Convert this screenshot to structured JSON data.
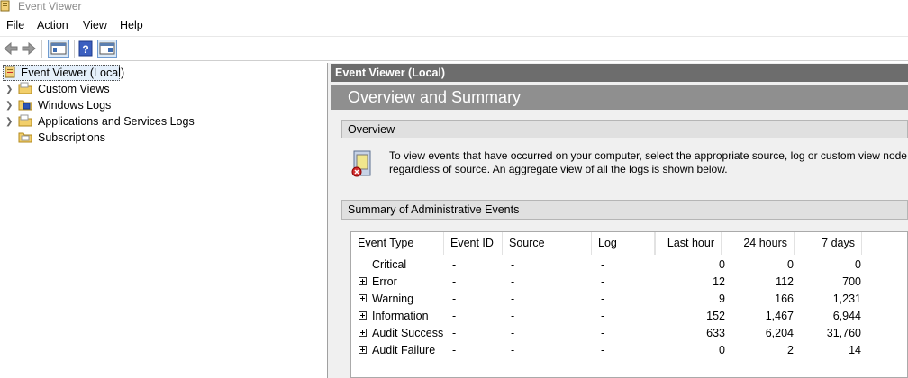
{
  "window": {
    "title": "Event Viewer"
  },
  "menu": [
    "File",
    "Action",
    "View",
    "Help"
  ],
  "toolbar": {
    "back_icon": "back-arrow-icon",
    "forward_icon": "forward-arrow-icon",
    "show_hide_tree_icon": "console-tree-icon",
    "help_icon": "help-icon",
    "show_hide_action_icon": "action-pane-icon"
  },
  "tree": {
    "root": "Event Viewer (Local)",
    "items": [
      {
        "label": "Custom Views",
        "icon": "folder-icon"
      },
      {
        "label": "Windows Logs",
        "icon": "folder-log-icon"
      },
      {
        "label": "Applications and Services Logs",
        "icon": "folder-icon"
      },
      {
        "label": "Subscriptions",
        "icon": "folder-subscriptions-icon"
      }
    ]
  },
  "right": {
    "header": "Event Viewer (Local)",
    "band_title": "Overview and Summary",
    "overview": {
      "title": "Overview",
      "text_line1": "To view events that have occurred on your computer, select the appropriate source, log or custom view node",
      "text_line2": "regardless of source. An aggregate view of all the logs is shown below."
    },
    "summary": {
      "title": "Summary of Administrative Events",
      "columns": [
        "Event Type",
        "Event ID",
        "Source",
        "Log",
        "Last hour",
        "24 hours",
        "7 days"
      ],
      "rows": [
        {
          "type": "Critical",
          "expandable": false,
          "id": "-",
          "source": "-",
          "log": "-",
          "hour": "0",
          "day": "0",
          "week": "0"
        },
        {
          "type": "Error",
          "expandable": true,
          "id": "-",
          "source": "-",
          "log": "-",
          "hour": "12",
          "day": "112",
          "week": "700"
        },
        {
          "type": "Warning",
          "expandable": true,
          "id": "-",
          "source": "-",
          "log": "-",
          "hour": "9",
          "day": "166",
          "week": "1,231"
        },
        {
          "type": "Information",
          "expandable": true,
          "id": "-",
          "source": "-",
          "log": "-",
          "hour": "152",
          "day": "1,467",
          "week": "6,944"
        },
        {
          "type": "Audit Success",
          "expandable": true,
          "id": "-",
          "source": "-",
          "log": "-",
          "hour": "633",
          "day": "6,204",
          "week": "31,760"
        },
        {
          "type": "Audit Failure",
          "expandable": true,
          "id": "-",
          "source": "-",
          "log": "-",
          "hour": "0",
          "day": "2",
          "week": "14"
        }
      ]
    }
  }
}
